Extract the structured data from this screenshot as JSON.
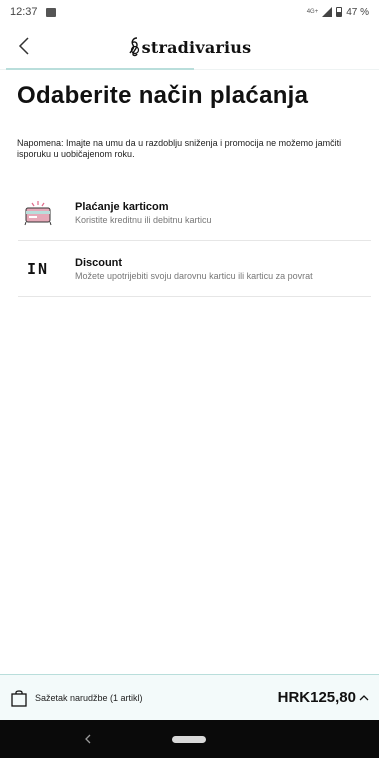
{
  "status_bar": {
    "time": "12:37",
    "network": "4G+",
    "battery": "47 %"
  },
  "header": {
    "brand": "stradivarius"
  },
  "page": {
    "title": "Odaberite način plaćanja",
    "notice": "Napomena: Imajte na umu da u razdoblju sniženja i promocija ne možemo jamčiti isporuku u uobičajenom roku."
  },
  "payment_methods": [
    {
      "title": "Plaćanje karticom",
      "subtitle": "Koristite kreditnu ili debitnu karticu",
      "icon": "credit-card-icon"
    },
    {
      "title": "Discount",
      "subtitle": "Možete upotrijebiti svoju darovnu karticu ili karticu za povrat",
      "icon": "in-logo-icon",
      "icon_text": "IN"
    }
  ],
  "summary": {
    "label": "Sažetak narudžbe (1 artikl)",
    "total": "HRK125,80"
  },
  "colors": {
    "accent": "#b9dedb",
    "summary_bg": "#f3fafa",
    "card_pink": "#e6a9b8"
  }
}
